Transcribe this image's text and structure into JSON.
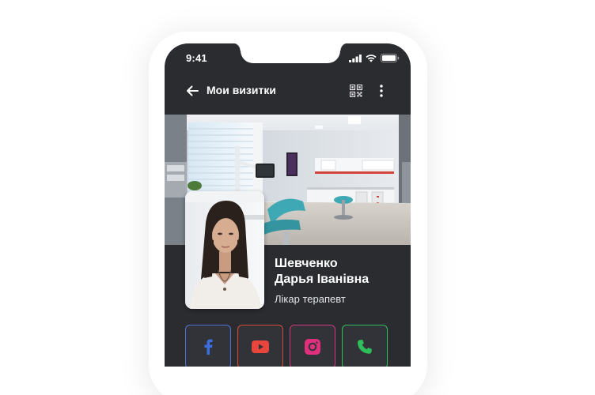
{
  "status_bar": {
    "time": "9:41",
    "icons": [
      "signal-icon",
      "wifi-icon",
      "battery-icon"
    ]
  },
  "app_bar": {
    "title": "Мои визитки",
    "back_icon": "arrow-left-icon",
    "qr_icon": "qr-code-icon",
    "more_icon": "more-vertical-icon"
  },
  "card": {
    "name_line1": "Шевченко",
    "name_line2": "Дарья Іванівна",
    "role": "Лікар терапевт"
  },
  "socials": [
    {
      "name": "facebook",
      "icon": "facebook-icon",
      "color": "#3b6fe0"
    },
    {
      "name": "youtube",
      "icon": "youtube-icon",
      "color": "#e8453c"
    },
    {
      "name": "instagram",
      "icon": "instagram-icon",
      "color": "#e0307d"
    },
    {
      "name": "phone",
      "icon": "phone-icon",
      "color": "#2fbf5a"
    }
  ],
  "colors": {
    "background": "#2b2c30",
    "surface": "#323338",
    "text": "#ffffff"
  }
}
